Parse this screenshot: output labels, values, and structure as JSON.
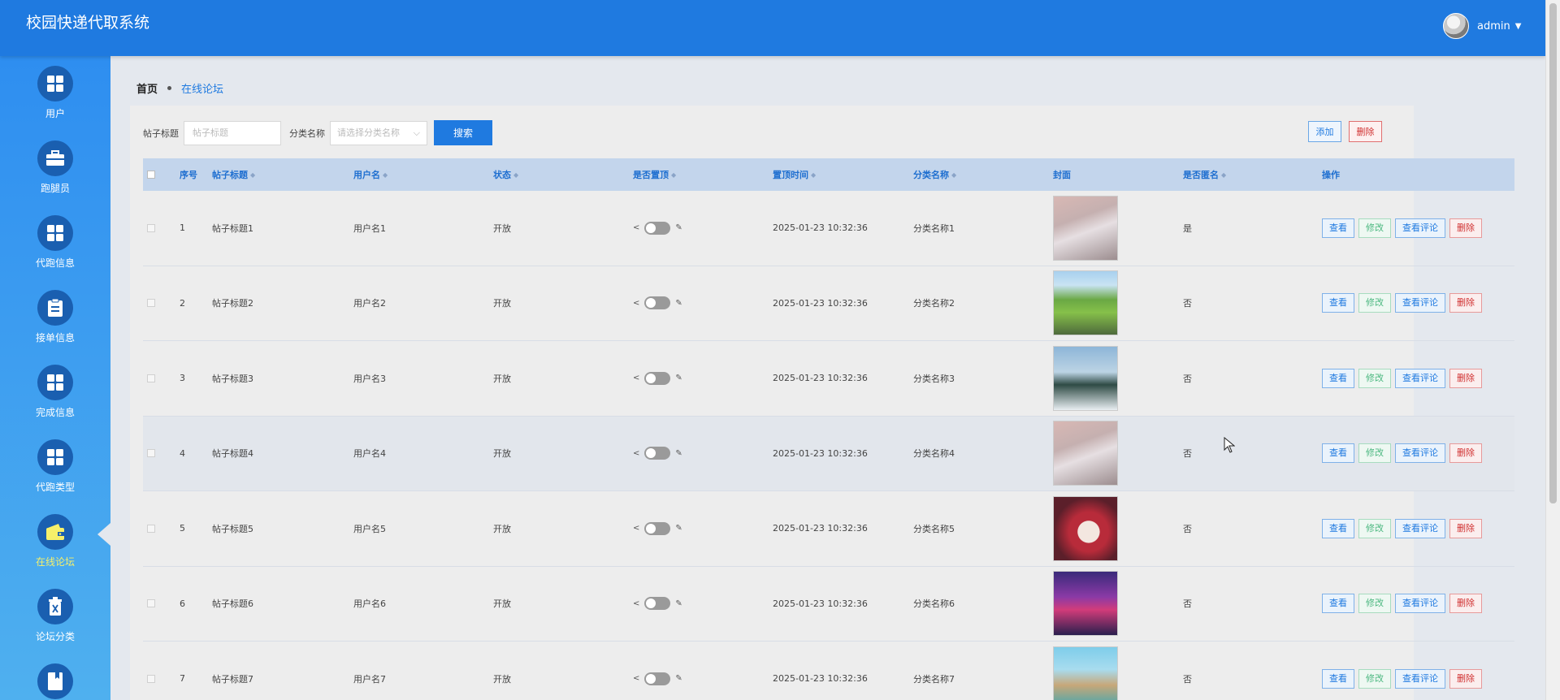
{
  "app": {
    "title": "校园快递代取系统",
    "username": "admin"
  },
  "sidebar": {
    "items": [
      {
        "label": "用户",
        "icon": "grid-icon"
      },
      {
        "label": "跑腿员",
        "icon": "briefcase-icon"
      },
      {
        "label": "代跑信息",
        "icon": "grid-icon"
      },
      {
        "label": "接单信息",
        "icon": "clipboard-icon"
      },
      {
        "label": "完成信息",
        "icon": "grid-icon"
      },
      {
        "label": "代跑类型",
        "icon": "grid-icon"
      },
      {
        "label": "在线论坛",
        "icon": "wallet-icon",
        "active": true
      },
      {
        "label": "论坛分类",
        "icon": "trash-icon"
      },
      {
        "label": "",
        "icon": "book-icon"
      }
    ]
  },
  "breadcrumb": {
    "home": "首页",
    "current": "在线论坛"
  },
  "search": {
    "title_label": "帖子标题",
    "title_placeholder": "帖子标题",
    "category_label": "分类名称",
    "category_placeholder": "请选择分类名称",
    "search_button": "搜索",
    "add_button": "添加",
    "delete_button": "删除"
  },
  "table": {
    "columns": [
      "序号",
      "帖子标题",
      "用户名",
      "状态",
      "是否置顶",
      "置顶时间",
      "分类名称",
      "封面",
      "是否匿名",
      "操作"
    ],
    "rows": [
      {
        "no": "1",
        "title": "帖子标题1",
        "user": "用户名1",
        "status": "开放",
        "top_time": "2025-01-23 10:32:36",
        "category": "分类名称1",
        "anonymous": "是"
      },
      {
        "no": "2",
        "title": "帖子标题2",
        "user": "用户名2",
        "status": "开放",
        "top_time": "2025-01-23 10:32:36",
        "category": "分类名称2",
        "anonymous": "否"
      },
      {
        "no": "3",
        "title": "帖子标题3",
        "user": "用户名3",
        "status": "开放",
        "top_time": "2025-01-23 10:32:36",
        "category": "分类名称3",
        "anonymous": "否"
      },
      {
        "no": "4",
        "title": "帖子标题4",
        "user": "用户名4",
        "status": "开放",
        "top_time": "2025-01-23 10:32:36",
        "category": "分类名称4",
        "anonymous": "否"
      },
      {
        "no": "5",
        "title": "帖子标题5",
        "user": "用户名5",
        "status": "开放",
        "top_time": "2025-01-23 10:32:36",
        "category": "分类名称5",
        "anonymous": "否"
      },
      {
        "no": "6",
        "title": "帖子标题6",
        "user": "用户名6",
        "status": "开放",
        "top_time": "2025-01-23 10:32:36",
        "category": "分类名称6",
        "anonymous": "否"
      },
      {
        "no": "7",
        "title": "帖子标题7",
        "user": "用户名7",
        "status": "开放",
        "top_time": "2025-01-23 10:32:36",
        "category": "分类名称7",
        "anonymous": "否"
      }
    ],
    "actions": {
      "view": "查看",
      "edit": "修改",
      "comments": "查看评论",
      "delete": "删除"
    }
  },
  "colors": {
    "primary": "#1f7ae0",
    "sidebar_active_text": "#f6f06a",
    "danger": "#d02f2f",
    "success": "#4cb880",
    "table_header_bg": "#c3d5ec"
  }
}
